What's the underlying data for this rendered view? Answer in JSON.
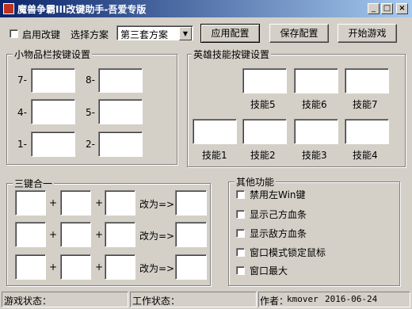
{
  "window": {
    "title": "魔兽争霸III改键助手-吾爱专版",
    "minimize": "_",
    "maximize": "□",
    "close": "×"
  },
  "toolbar": {
    "enable_label": "启用改键",
    "scheme_label": "选择方案",
    "scheme_value": "第三套方案",
    "apply_label": "应用配置",
    "save_label": "保存配置",
    "start_label": "开始游戏"
  },
  "items_group": {
    "title": "小物品栏按键设置",
    "slots": [
      {
        "label": "7-",
        "value": ""
      },
      {
        "label": "8-",
        "value": ""
      },
      {
        "label": "4-",
        "value": ""
      },
      {
        "label": "5-",
        "value": ""
      },
      {
        "label": "1-",
        "value": ""
      },
      {
        "label": "2-",
        "value": ""
      }
    ]
  },
  "hero_group": {
    "title": "英雄技能按键设置",
    "skills": [
      {
        "label": "技能5",
        "value": ""
      },
      {
        "label": "技能6",
        "value": ""
      },
      {
        "label": "技能7",
        "value": ""
      },
      {
        "label": "技能1",
        "value": ""
      },
      {
        "label": "技能2",
        "value": ""
      },
      {
        "label": "技能3",
        "value": ""
      },
      {
        "label": "技能4",
        "value": ""
      }
    ]
  },
  "combo_group": {
    "title": "三键合一",
    "plus": "+",
    "change_to": "改为=>"
  },
  "other_group": {
    "title": "其他功能",
    "options": [
      {
        "label": "禁用左Win键",
        "checked": false
      },
      {
        "label": "显示己方血条",
        "checked": false
      },
      {
        "label": "显示敌方血条",
        "checked": false
      },
      {
        "label": "窗口模式锁定鼠标",
        "checked": false
      },
      {
        "label": "窗口最大",
        "checked": false
      }
    ]
  },
  "statusbar": {
    "game_status_label": "游戏状态：",
    "game_status_value": "",
    "work_status_label": "工作状态：",
    "work_status_value": "",
    "author_label": "作者：",
    "author_value": "kmover",
    "date": "2016-06-24"
  }
}
